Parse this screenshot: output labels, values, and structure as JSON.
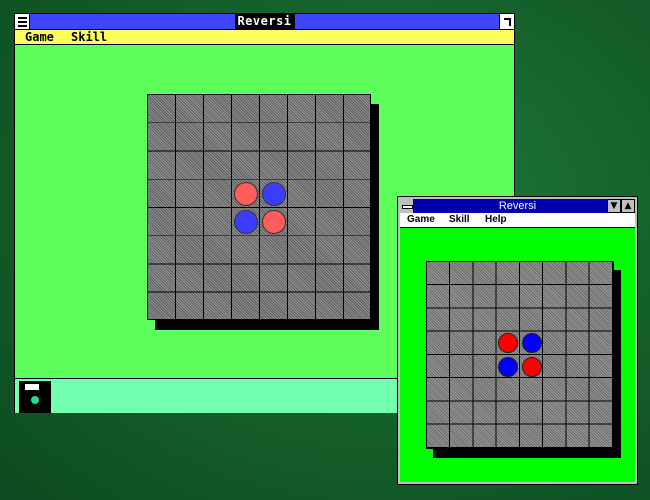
{
  "window_large": {
    "title": "Reversi",
    "menu": [
      "Game",
      "Skill"
    ],
    "board": {
      "rows": 8,
      "cols": 8,
      "pieces": [
        {
          "row": 3,
          "col": 3,
          "color": "red"
        },
        {
          "row": 3,
          "col": 4,
          "color": "blue"
        },
        {
          "row": 4,
          "col": 3,
          "color": "blue"
        },
        {
          "row": 4,
          "col": 4,
          "color": "red"
        }
      ]
    },
    "status_icon": "floppy-disk-icon"
  },
  "window_small": {
    "title": "Reversi",
    "menu": [
      "Game",
      "Skill",
      "Help"
    ],
    "minimize_glyph": "▼",
    "maximize_glyph": "▲",
    "board": {
      "rows": 8,
      "cols": 8,
      "pieces": [
        {
          "row": 3,
          "col": 3,
          "color": "red"
        },
        {
          "row": 3,
          "col": 4,
          "color": "blue"
        },
        {
          "row": 4,
          "col": 3,
          "color": "blue"
        },
        {
          "row": 4,
          "col": 4,
          "color": "red"
        }
      ]
    }
  },
  "colors": {
    "desktop": "#1a6b32",
    "w1_client": "#5dff5d",
    "w1_title": "#3d45ff",
    "w1_menu": "#ffff5d",
    "w2_client": "#00ff00",
    "w2_title": "#0000b0",
    "red_piece_large": "#ff5c5c",
    "blue_piece_large": "#3c3cff",
    "red_piece_small": "#ff0000",
    "blue_piece_small": "#0000ff"
  }
}
